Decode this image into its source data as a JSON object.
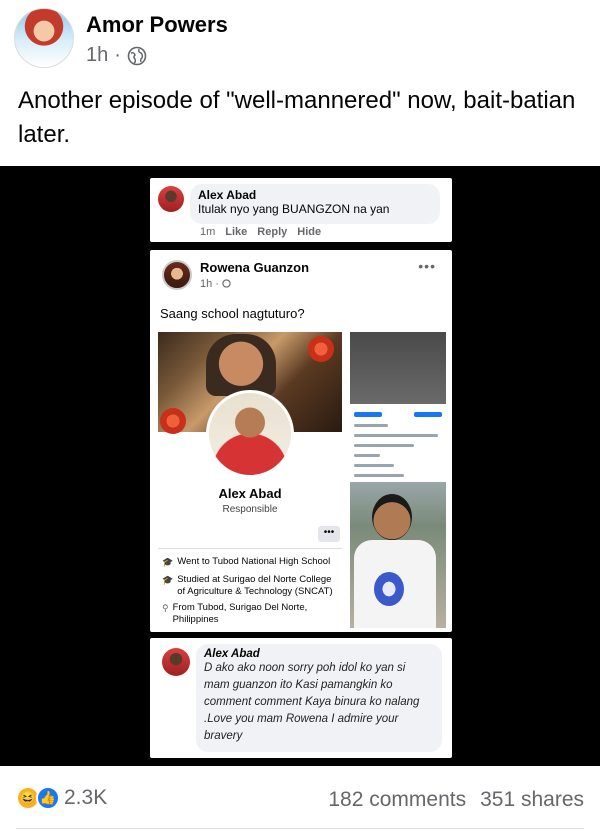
{
  "post": {
    "author": "Amor Powers",
    "time": "1h",
    "separator": "·",
    "text": "Another episode of \"well-mannered\" now, bait-batian later."
  },
  "embedded": {
    "comment1": {
      "name": "Alex Abad",
      "text": "Itulak nyo yang BUANGZON na yan",
      "time": "1m",
      "like": "Like",
      "reply": "Reply",
      "hide": "Hide"
    },
    "post2": {
      "author": "Rowena Guanzon",
      "time": "1h ·",
      "more": "•••",
      "text": "Saang school nagtuturo?"
    },
    "profile": {
      "name": "Alex Abad",
      "subtitle": "Responsible",
      "more": "•••",
      "info1": "Went to Tubod National High School",
      "info2": "Studied at Surigao del Norte College of Agriculture & Technology (SNCAT)",
      "info3": "From Tubod, Surigao Del Norte, Philippines"
    },
    "comment2": {
      "name": "Alex Abad",
      "text": "D ako ako noon sorry poh idol ko yan si mam guanzon ito Kasi pamangkin ko comment comment Kaya binura ko nalang .Love you mam Rowena I admire your bravery"
    }
  },
  "footer": {
    "reaction_count": "2.3K",
    "comments": "182 comments",
    "shares": "351 shares"
  },
  "icons": {
    "globe": "globe-icon",
    "haha": "haha-reaction-icon",
    "like": "like-reaction-icon"
  }
}
